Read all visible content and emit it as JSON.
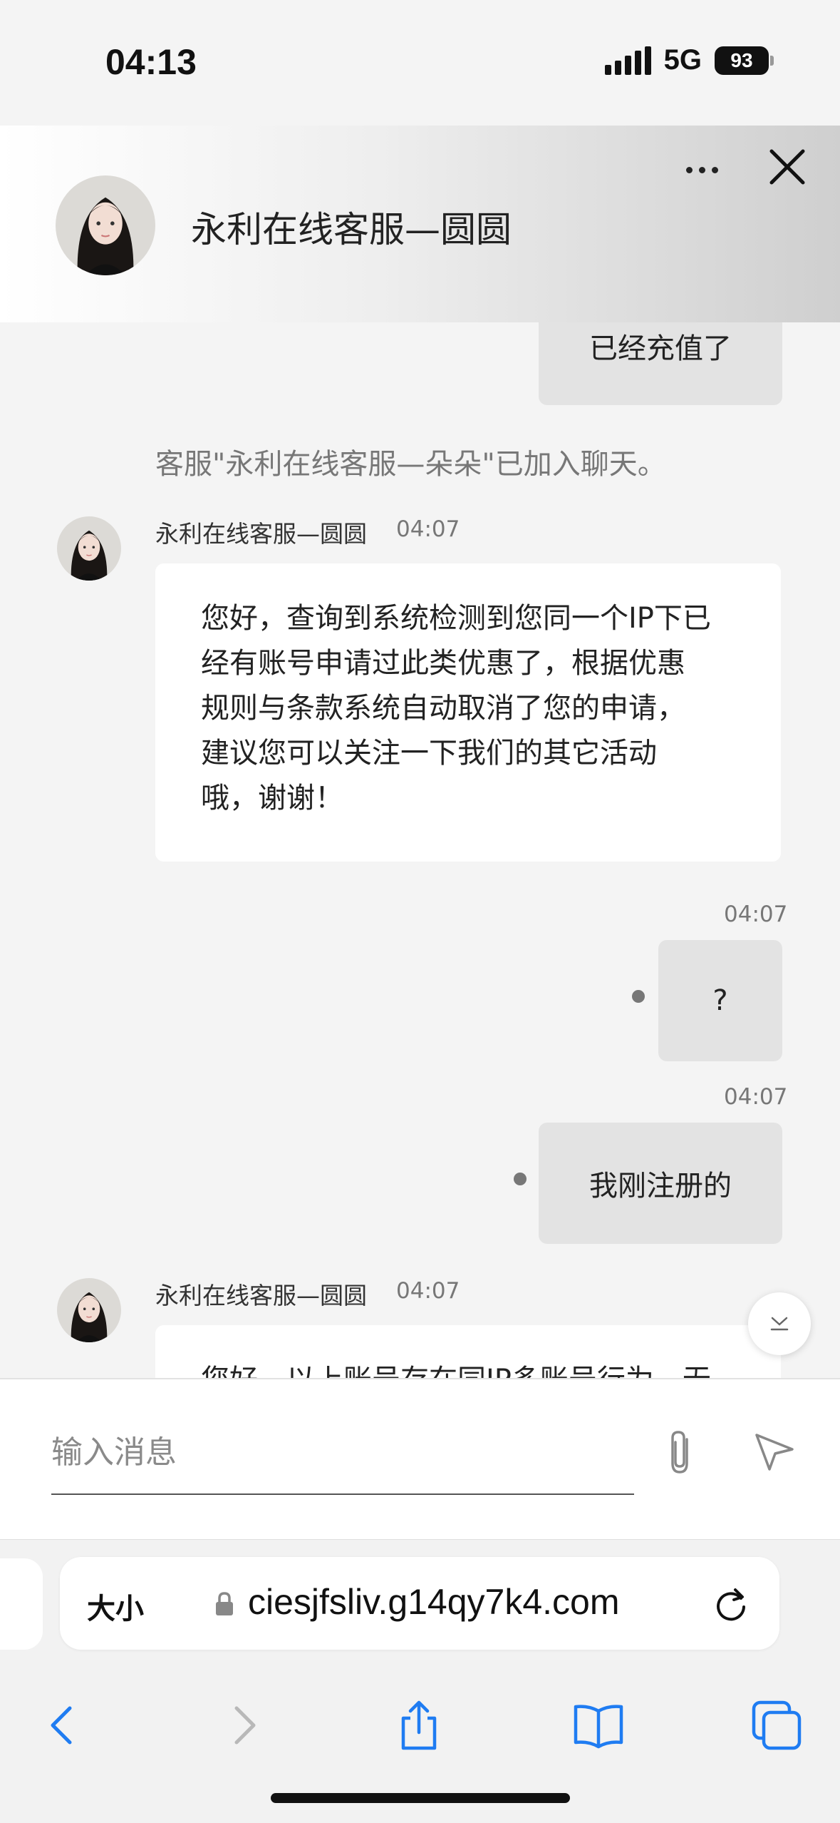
{
  "status_bar": {
    "time": "04:13",
    "network": "5G",
    "battery": "93"
  },
  "header": {
    "title": "永利在线客服—圆圆"
  },
  "messages": {
    "top_partial_bubble": "已经充值了",
    "system_notice": "客服\"永利在线客服—朵朵\"已加入聊天。",
    "agent_msg_1": {
      "name": "永利在线客服—圆圆",
      "time": "04:07",
      "lines": [
        "您好，查询到系统检测到您同一个IP下已",
        "经有账号申请过此类优惠了，根据优惠",
        "规则与条款系统自动取消了您的申请，",
        "建议您可以关注一下我们的其它活动",
        "哦，谢谢！"
      ]
    },
    "user_msg_1": {
      "time": "04:07",
      "text": "?"
    },
    "user_msg_2": {
      "time": "04:07",
      "text": "我刚注册的"
    },
    "agent_msg_2": {
      "name": "永利在线客服—圆圆",
      "time": "04:07",
      "partial_text": "您好，以上账号存在同IP多账号行为，无"
    }
  },
  "input": {
    "placeholder": "输入消息"
  },
  "browser": {
    "text_size_label": "大小",
    "url": "ciesjfsliv.g14qy7k4.com"
  },
  "colors": {
    "accent_blue": "#1f7cf2",
    "bubble_gray": "#e3e3e3",
    "background": "#f4f4f4"
  },
  "icons": [
    "more-icon",
    "close-icon",
    "attach-icon",
    "send-icon",
    "lock-icon",
    "reload-icon",
    "back-icon",
    "forward-icon",
    "share-icon",
    "bookmarks-icon",
    "tabs-icon",
    "chevron-down-icon"
  ]
}
